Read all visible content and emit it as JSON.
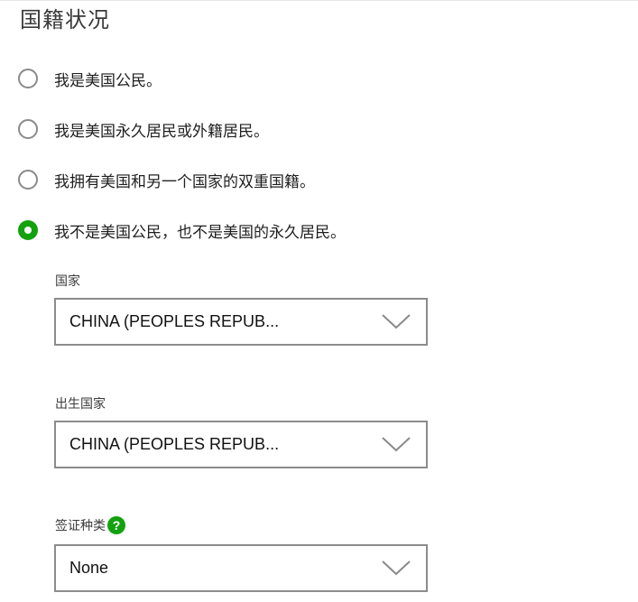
{
  "section": {
    "title": "国籍状况"
  },
  "citizenship_options": [
    {
      "label": "我是美国公民。",
      "selected": false
    },
    {
      "label": "我是美国永久居民或外籍居民。",
      "selected": false
    },
    {
      "label": "我拥有美国和另一个国家的双重国籍。",
      "selected": false
    },
    {
      "label": "我不是美国公民，也不是美国的永久居民。",
      "selected": true
    }
  ],
  "fields": {
    "country": {
      "label": "国家",
      "value": "CHINA (PEOPLES REPUB..."
    },
    "birth_country": {
      "label": "出生国家",
      "value": "CHINA (PEOPLES REPUB..."
    },
    "visa_type": {
      "label": "签证种类",
      "help_symbol": "?",
      "value": "None"
    }
  },
  "colors": {
    "accent": "#13a10e",
    "border": "#8c8c8c"
  }
}
